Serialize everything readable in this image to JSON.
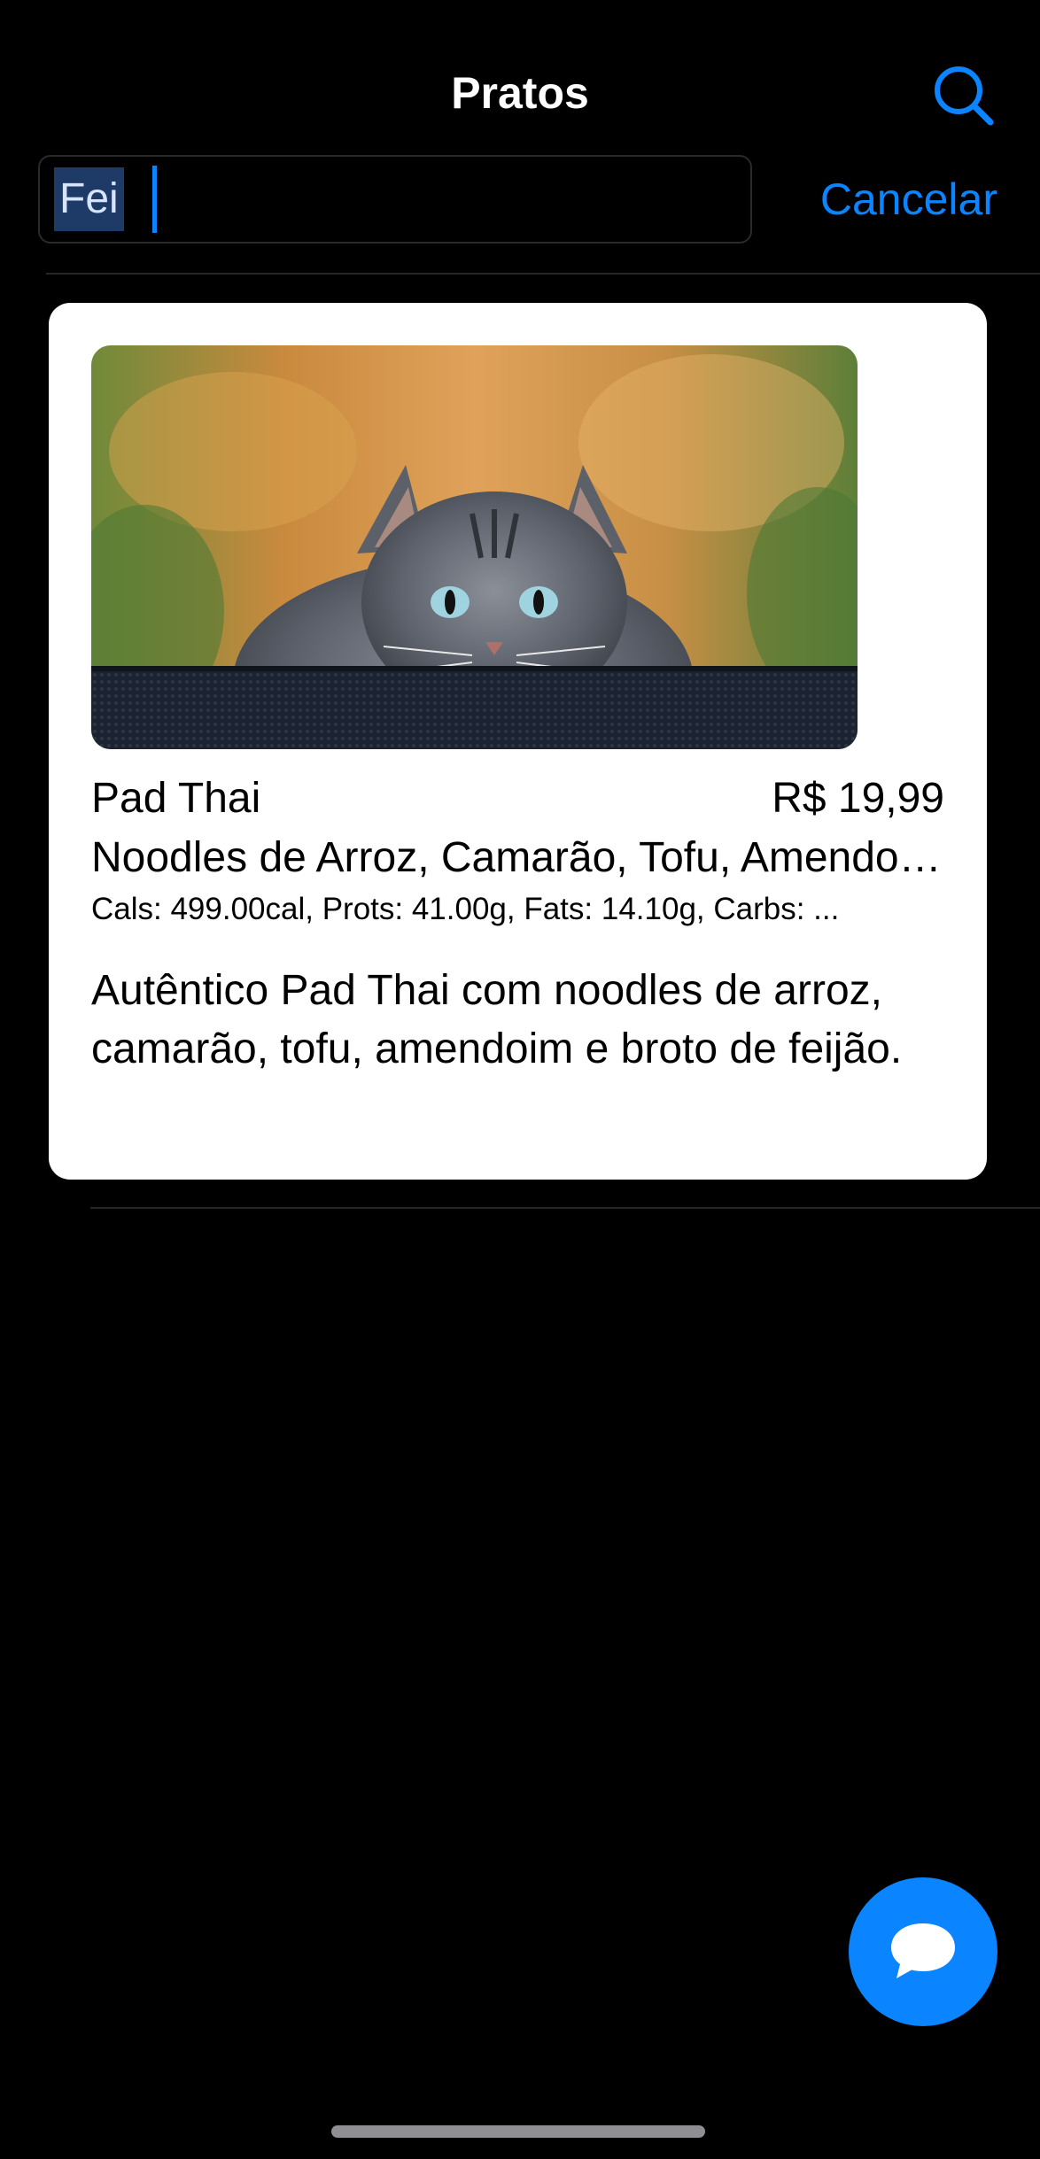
{
  "nav": {
    "title": "Pratos"
  },
  "search": {
    "value": "Fei",
    "cancel_label": "Cancelar"
  },
  "dishes": [
    {
      "name": "Pad Thai",
      "price": "R$ 19,99",
      "ingredients": "Noodles de Arroz, Camarão, Tofu, Amendoim, Broto de Feijão",
      "macros": "Cals: 499.00cal, Prots: 41.00g, Fats: 14.10g, Carbs: ...",
      "description": "Autêntico Pad Thai com noodles de arroz, camarão, tofu, amendoim e broto de feijão."
    }
  ],
  "colors": {
    "accent": "#0a84ff",
    "background": "#000000",
    "card": "#ffffff"
  },
  "icons": {
    "search_toggle": "search-icon",
    "chat": "chat-bubble-icon"
  }
}
